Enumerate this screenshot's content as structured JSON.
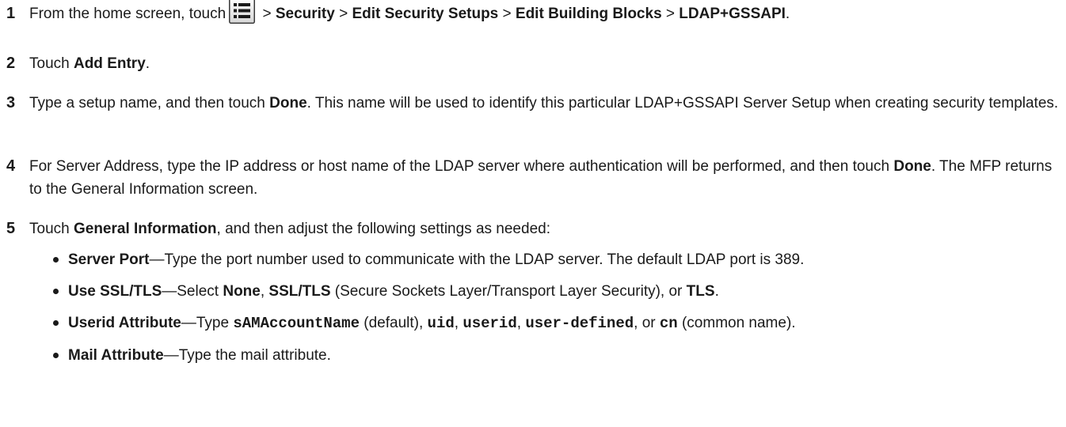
{
  "steps": [
    {
      "number": "1",
      "parts": {
        "a": "From the home screen, touch",
        "b": " > ",
        "c": "Security",
        "d": " > ",
        "e": "Edit Security Setups",
        "f": " > ",
        "g": "Edit Building Blocks",
        "h": " > ",
        "i": "LDAP+GSSAPI",
        "j": "."
      },
      "icon": "menu-list-icon"
    },
    {
      "number": "2",
      "parts": {
        "a": "Touch ",
        "b": "Add Entry",
        "c": "."
      }
    },
    {
      "number": "3",
      "parts": {
        "a": "Type a setup name, and then touch ",
        "b": "Done",
        "c": ". This name will be used to identify this particular LDAP+GSSAPI Server Setup when creating security templates."
      }
    },
    {
      "number": "4",
      "parts": {
        "a": "For Server Address, type the IP address or host name of the LDAP server where authentication will be performed, and then touch ",
        "b": "Done",
        "c": ". The MFP returns to the General Information screen."
      }
    },
    {
      "number": "5",
      "parts": {
        "a": "Touch ",
        "b": "General Information",
        "c": ", and then adjust the following settings as needed:"
      }
    }
  ],
  "bullets": [
    {
      "term": "Server Port",
      "text": "—Type the port number used to communicate with the LDAP server. The default LDAP port is 389."
    },
    {
      "term": "Use SSL/TLS",
      "t1": "—Select ",
      "b1": "None",
      "t2": ", ",
      "b2": "SSL/TLS",
      "t3": " (Secure Sockets Layer/Transport Layer Security), or ",
      "b3": "TLS",
      "t4": "."
    },
    {
      "term": "Userid Attribute",
      "t1": "—Type ",
      "c1": "sAMAccountName",
      "t2": " (default), ",
      "c2": "uid",
      "t3": ", ",
      "c3": "userid",
      "t4": ", ",
      "c4": "user-defined",
      "t5": ", or ",
      "c5": "cn",
      "t6": " (common name)."
    },
    {
      "term": "Mail Attribute",
      "text": "—Type the mail attribute."
    }
  ],
  "colors": {
    "icon_border": "#3a3a3a",
    "icon_bg_top": "#ffffff",
    "icon_bg_bottom": "#d9d9d9",
    "text": "#1a1a1a"
  }
}
